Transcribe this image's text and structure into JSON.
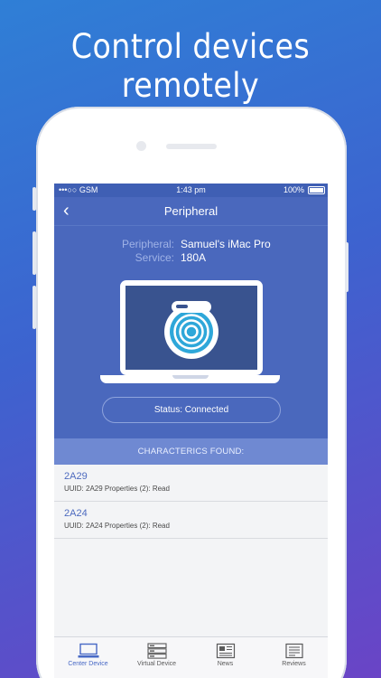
{
  "headline": "Control devices remotely",
  "status_bar": {
    "signal": "•••○○ GSM",
    "time": "1:43 pm",
    "battery": "100%"
  },
  "nav": {
    "title": "Peripheral",
    "back_icon": "chevron-left-icon"
  },
  "device": {
    "peripheral_label": "Peripheral:",
    "peripheral_value": "Samuel's iMac Pro",
    "service_label": "Service:",
    "service_value": "180A"
  },
  "status": {
    "text": "Status: Connected"
  },
  "characteristics": {
    "header": "CHARACTERICS FOUND:",
    "items": [
      {
        "id": "2A29",
        "detail": "UUID: 2A29 Properties (2): Read"
      },
      {
        "id": "2A24",
        "detail": "UUID: 2A24 Properties (2): Read"
      }
    ]
  },
  "tabs": [
    {
      "label": "Center Device",
      "icon": "laptop-icon",
      "active": true
    },
    {
      "label": "Virtual Device",
      "icon": "server-icon",
      "active": false
    },
    {
      "label": "News",
      "icon": "newspaper-icon",
      "active": false
    },
    {
      "label": "Reviews",
      "icon": "reviews-icon",
      "active": false
    }
  ],
  "colors": {
    "accent": "#4768c5",
    "hero": "#4a68bd",
    "section": "#6f89d2"
  }
}
